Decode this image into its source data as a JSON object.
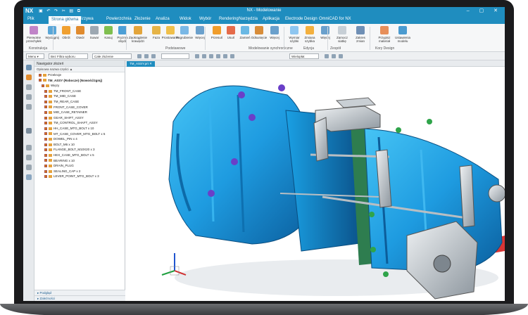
{
  "app": {
    "logo": "NX",
    "title": "NX - Modelowanie",
    "window_controls": "– ▢ ✕"
  },
  "menu_tabs": [
    {
      "label": "Plik"
    },
    {
      "label": "Strona główna",
      "active": true
    },
    {
      "label": "Krzywa"
    },
    {
      "label": "Powierzchnia"
    },
    {
      "label": "Złożenie"
    },
    {
      "label": "Analiza"
    },
    {
      "label": "Widok"
    },
    {
      "label": "Wybór"
    },
    {
      "label": "Rendering"
    },
    {
      "label": "Narzędzia"
    },
    {
      "label": "Aplikacja"
    },
    {
      "label": "Electrode Design"
    },
    {
      "label": "OmniCAD for NX"
    }
  ],
  "ribbon": {
    "buttons": [
      {
        "label": "Pierwotne\nprzechyłek",
        "color": "#c084c8"
      },
      {
        "label": "Wyciągnij",
        "color": "#5aa7d8"
      },
      {
        "label": "Obrót",
        "color": "#f0a030"
      },
      {
        "label": "Otwór",
        "color": "#e08b2e"
      },
      {
        "label": "Suwar",
        "color": "#9da8b2"
      },
      {
        "label": "Kasuj",
        "color": "#7fbf4f"
      },
      {
        "label": "Pryzma\nobydż",
        "color": "#4c9fd6"
      },
      {
        "label": "Zaokrąglenie\nkrawędzi",
        "color": "#e3a53b"
      },
      {
        "label": "Faza",
        "color": "#e6b447"
      },
      {
        "label": "Prostowanie",
        "color": "#f0c04a"
      },
      {
        "label": "Pogrubienie",
        "color": "#7ab8e6"
      },
      {
        "label": "Więcej",
        "color": "#6aa0cc"
      },
      {
        "label": "Przesuń",
        "color": "#f09d2b"
      },
      {
        "label": "Usuń",
        "color": "#e56b4a"
      },
      {
        "label": "Zamień",
        "color": "#6ab8e4"
      },
      {
        "label": "Odsunięcie",
        "color": "#d88d3a"
      },
      {
        "label": "Więcej",
        "color": "#6aa0cc"
      },
      {
        "label": "Wymiar\nszybki",
        "color": "#8ec6f0"
      },
      {
        "label": "Zmiana\nszybka",
        "color": "#f3b03e"
      },
      {
        "label": "Więcej",
        "color": "#6aa0cc"
      },
      {
        "label": "Zamocz\nsiatkę",
        "color": "#c7cfd6"
      },
      {
        "label": "Zakres\nzmian",
        "color": "#6f8fb5"
      },
      {
        "label": "Przypisz\nmateriał",
        "color": "#e78f5a"
      },
      {
        "label": "Ustawienia\nmodelu",
        "color": "#4b9bd0"
      }
    ],
    "groups": [
      "Konstrukcja",
      "Podstawowe",
      "Modelowanie synchroniczne",
      "Edycja",
      "Zespół",
      "Kory Design"
    ]
  },
  "toolbar": {
    "menu": "Menu ▾",
    "filter": "Bez Filtra wyboru",
    "scope": "Całe złożenie",
    "mode": "Wielopłat"
  },
  "navigator": {
    "title": "Nawigator złożeń",
    "column": "Opisowa nazwa części ▲",
    "rows": [
      {
        "indent": 1,
        "label": "Przekroje"
      },
      {
        "indent": 1,
        "label": "TM_ASSY (Robocze) (Nowość/zgmj)",
        "bold": true
      },
      {
        "indent": 2,
        "label": "Więzy"
      },
      {
        "indent": 3,
        "label": "TM_FRONT_CASE"
      },
      {
        "indent": 3,
        "label": "TM_MID_CASE"
      },
      {
        "indent": 3,
        "label": "TM_REAR_CASE"
      },
      {
        "indent": 3,
        "label": "FRONT_CASE_COVER"
      },
      {
        "indent": 3,
        "label": "MID_CASE_RETAINER"
      },
      {
        "indent": 3,
        "label": "GEAR_SHIFT_ASSY"
      },
      {
        "indent": 3,
        "label": "TM_CONTROL_SHAFT_ASSY"
      },
      {
        "indent": 3,
        "label": "HH_CASE_MTG_BOLT x 10"
      },
      {
        "indent": 3,
        "label": "MT_CASE_COVER_MTG_BOLT x 5"
      },
      {
        "indent": 3,
        "label": "DOWEL_PIN x 4"
      },
      {
        "indent": 3,
        "label": "BOLT_M6 x 10"
      },
      {
        "indent": 3,
        "label": "FLANGE_BOLT_M10X20 x 3"
      },
      {
        "indent": 3,
        "label": "HEX_CASE_MTG_BOLT x 5"
      },
      {
        "indent": 3,
        "label": "BEARING x 10"
      },
      {
        "indent": 3,
        "label": "DRAIN_PLUG"
      },
      {
        "indent": 3,
        "label": "SEALING_CAP x 2"
      },
      {
        "indent": 3,
        "label": "LEVER_POINT_MTG_BOLT x 3"
      }
    ],
    "footer": [
      "Podgląd",
      "Zależności"
    ]
  },
  "viewport": {
    "tab": "TM_ASSY.prt ✕"
  },
  "colors": {
    "titlebar": "#1f8dbf",
    "housing": "#1e9be0",
    "housing_dark": "#0c5d9a",
    "accent_green": "#2e7d4f"
  }
}
